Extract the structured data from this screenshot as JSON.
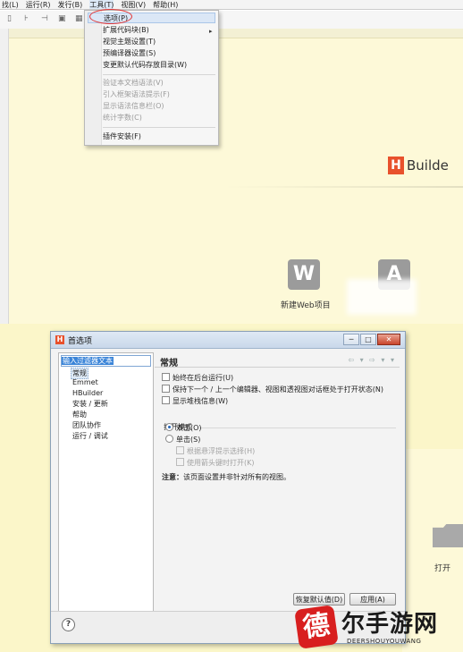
{
  "menubar": {
    "items": [
      "找(L)",
      "运行(R)",
      "发行(B)",
      "工具(T)",
      "视图(V)",
      "帮助(H)"
    ]
  },
  "tools_menu": {
    "items": [
      {
        "label": "选项(P)",
        "state": "selected"
      },
      {
        "label": "扩展代码块(B)",
        "state": "normal",
        "submenu": true
      },
      {
        "label": "视觉主题设置(T)",
        "state": "normal"
      },
      {
        "label": "预编译器设置(S)",
        "state": "normal"
      },
      {
        "label": "变更默认代码存放目录(W)",
        "state": "normal"
      },
      {
        "label": "验证本文档语法(V)",
        "state": "disabled"
      },
      {
        "label": "引入框架语法提示(F)",
        "state": "disabled"
      },
      {
        "label": "显示语法信息栏(O)",
        "state": "disabled"
      },
      {
        "label": "统计字数(C)",
        "state": "disabled"
      },
      {
        "label": "插件安装(F)",
        "state": "normal"
      }
    ],
    "submenu_arrow": "▸"
  },
  "welcome": {
    "logo_letter": "H",
    "logo_text": "Builde",
    "new_web_icon": "W",
    "new_web_label": "新建Web项目",
    "second_icon": "A",
    "folder_label": "打开"
  },
  "dialog": {
    "title": "首选项",
    "app_icon_letter": "H",
    "win_minimize": "─",
    "win_maximize": "□",
    "win_close": "✕",
    "filter_text": "输入过滤器文本",
    "tree": [
      "常规",
      "Emmet",
      "HBuilder",
      "安装 / 更新",
      "帮助",
      "团队协作",
      "运行 / 调试"
    ],
    "panel_title": "常规",
    "nav_arrows": "⇦ ▾ ⇨ ▾ ▾",
    "options": [
      {
        "label": "始终在后台运行(U)",
        "checked": false
      },
      {
        "label": "保持下一个 / 上一个编辑器、视图和透视图对话框处于打开状态(N)",
        "checked": false
      },
      {
        "label": "显示堆栈信息(W)",
        "checked": false
      }
    ],
    "open_mode_label": "打开模式",
    "radio_double": "双击(O)",
    "radio_single": "单击(S)",
    "sub_options": [
      {
        "label": "根据悬浮提示选择(H)",
        "checked": false
      },
      {
        "label": "使用箭头键时打开(K)",
        "checked": false
      }
    ],
    "note_bold": "注意：",
    "note_text": "该页面设置并非针对所有的视图。",
    "restore_defaults": "恢复默认值(D)",
    "apply": "应用(A)",
    "help_symbol": "?"
  },
  "watermark": {
    "logo_char": "德",
    "text": "尔手游网",
    "url": "DEERSHOUYOUWANG"
  }
}
